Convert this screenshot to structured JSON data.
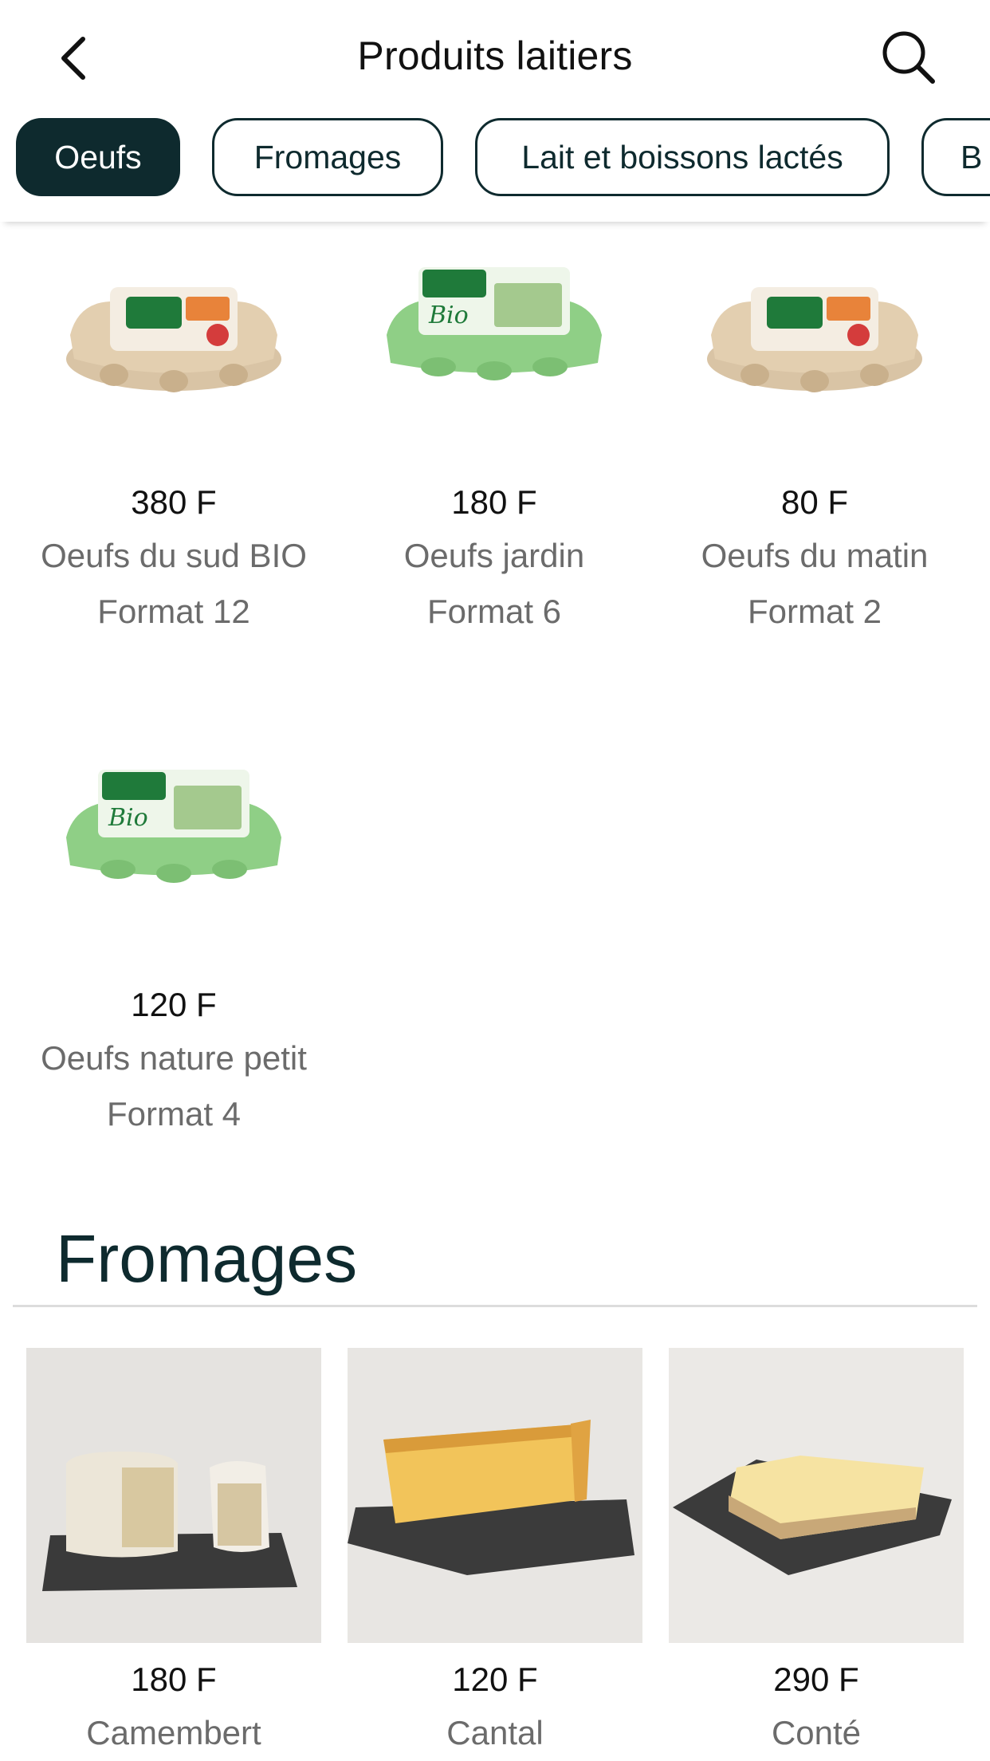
{
  "header": {
    "title": "Produits laitiers",
    "back_icon": "chevron-left-icon",
    "search_icon": "search-icon"
  },
  "tabs": [
    {
      "label": "Oeufs",
      "active": true
    },
    {
      "label": "Fromages",
      "active": false
    },
    {
      "label": "Lait et boissons lactés",
      "active": false
    },
    {
      "label": "B",
      "active": false
    }
  ],
  "eggs": [
    {
      "price": "380 F",
      "name": "Oeufs du sud BIO",
      "format": "Format 12",
      "image": "egg-carton-termier"
    },
    {
      "price": "180 F",
      "name": "Oeufs jardin",
      "format": "Format 6",
      "image": "egg-carton-bio"
    },
    {
      "price": "80 F",
      "name": "Oeufs du matin",
      "format": "Format 2",
      "image": "egg-carton-termier"
    },
    {
      "price": "120 F",
      "name": "Oeufs nature petit",
      "format": "Format 4",
      "image": "egg-carton-bio"
    }
  ],
  "cheese_section": {
    "title": "Fromages",
    "items": [
      {
        "price": "180 F",
        "name": "Camembert",
        "image": "cheese-camembert"
      },
      {
        "price": "120 F",
        "name": "Cantal",
        "image": "cheese-cantal"
      },
      {
        "price": "290 F",
        "name": "Conté",
        "image": "cheese-comte"
      }
    ]
  },
  "colors": {
    "brand_dark": "#0e2a2e",
    "muted_text": "#6b6b6b",
    "carton_green": "#8fcf86",
    "carton_kraft": "#d9c4a5",
    "label_green": "#1f7a3a"
  }
}
